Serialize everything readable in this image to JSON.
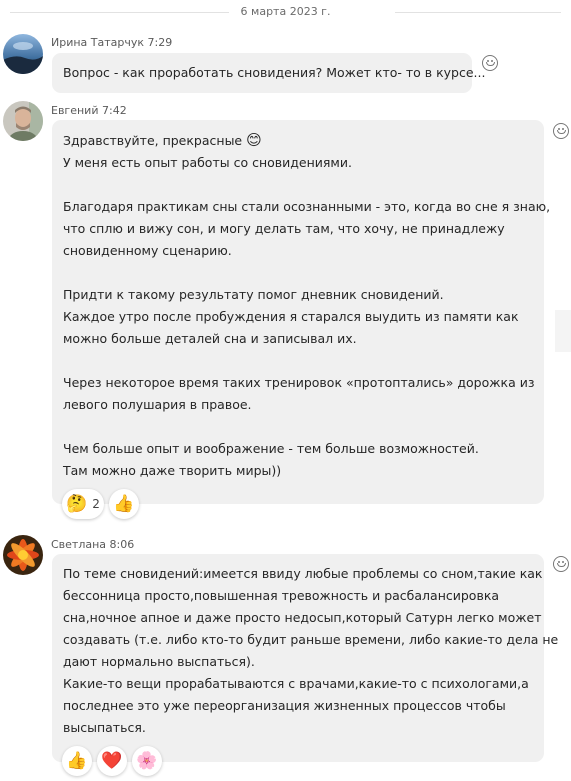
{
  "date_divider": "6 марта 2023 г.",
  "messages": [
    {
      "sender": "Ирина Татарчук",
      "time": "7:29",
      "lines": [
        "Вопрос - как проработать сновидения? Может кто- то в курсе..."
      ]
    },
    {
      "sender": "Евгений",
      "time": "7:42",
      "lines": [
        "Здравствуйте, прекрасные",
        "У меня есть опыт работы со сновидениями.",
        "",
        "Благодаря практикам сны стали осознанными - это, когда во сне я знаю,",
        "что сплю и вижу сон, и могу делать там, что хочу, не принадлежу",
        "сновиденному сценарию.",
        "",
        "Придти к такому результату помог дневник сновидений.",
        "Каждое утро после пробуждения я старался выудить из памяти как",
        "можно больше деталей сна и записывал их.",
        "",
        "Через некоторое время таких тренировок «протоптались» дорожка из",
        "левого полушария в правое.",
        "",
        "Чем больше опыт и воображение - тем больше возможностей.",
        "Там можно даже творить миры))"
      ],
      "inline_emoji": "😊",
      "reactions": [
        {
          "icon": "🤔",
          "count": "2"
        },
        {
          "icon": "👍",
          "count": ""
        }
      ]
    },
    {
      "sender": "Светлана",
      "time": "8:06",
      "lines": [
        "По теме сновидений:имеется ввиду любые проблемы со сном,такие как",
        "бессонница просто,повышенная тревожность и расбалансировка",
        "сна,ночное апное и даже просто недосып,который Сатурн легко может",
        "создавать (т.е. либо кто-то будит раньше времени, либо какие-то дела не",
        "дают нормально выспаться).",
        "Какие-то вещи прорабатываются с врачами,какие-то с психологами,а",
        "последнее это уже переорганизация жизненных процессов чтобы",
        "высыпаться."
      ],
      "reactions": [
        {
          "icon": "👍",
          "count": ""
        },
        {
          "icon": "❤️",
          "count": ""
        },
        {
          "icon": "🌸",
          "count": ""
        }
      ]
    }
  ]
}
